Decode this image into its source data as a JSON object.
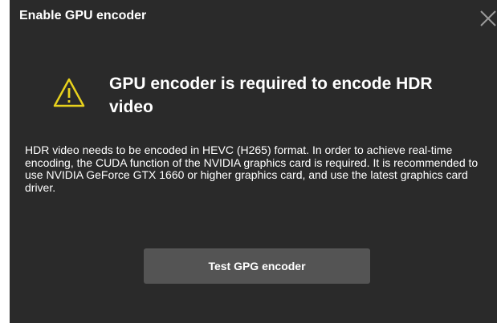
{
  "dialog": {
    "title": "Enable GPU encoder",
    "close_icon": "close-icon",
    "warning_icon": "warning-triangle-icon",
    "heading": "GPU encoder is required to encode HDR video",
    "body": "HDR video needs to be encoded in HEVC (H265) format. In order to achieve real-time encoding, the CUDA function of the NVIDIA graphics card is required. It is recommended to use NVIDIA GeForce GTX 1660 or higher graphics card, and use the latest graphics card driver.",
    "button_label": "Test GPG encoder"
  },
  "colors": {
    "dialog_background": "#2a2a2a",
    "button_background": "#545454",
    "warning_yellow": "#e8d21d",
    "text": "#ffffff"
  }
}
